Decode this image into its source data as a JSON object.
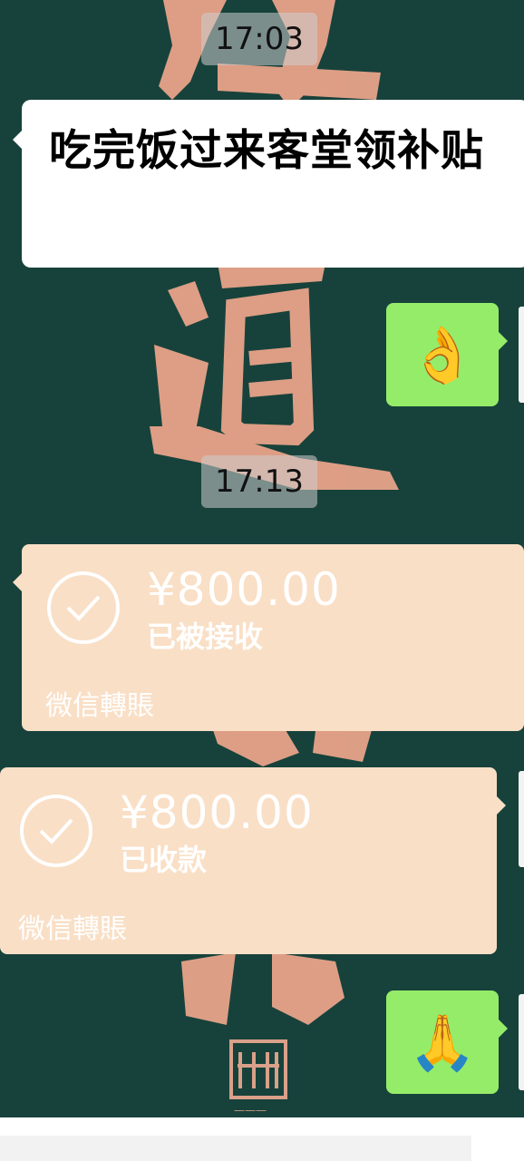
{
  "timestamps": [
    "17:03",
    "17:13"
  ],
  "messages": {
    "incoming_text": "吃完饭过来客堂领补贴",
    "reply_ok_emoji": "👌",
    "reply_thanks_emoji": "🙏"
  },
  "transfers": [
    {
      "amount": "¥800.00",
      "status": "已被接收",
      "label": "微信轉賬"
    },
    {
      "amount": "¥800.00",
      "status": "已收款",
      "label": "微信轉賬"
    }
  ],
  "colors": {
    "background": "#17423b",
    "calligraphy": "#e8a38a",
    "bubble_green": "#95ec69",
    "transfer_bg": "#f9dfc6"
  },
  "icons": {
    "transfer_status": "check-circle-icon",
    "wallpaper_seal": "seal-icon"
  }
}
